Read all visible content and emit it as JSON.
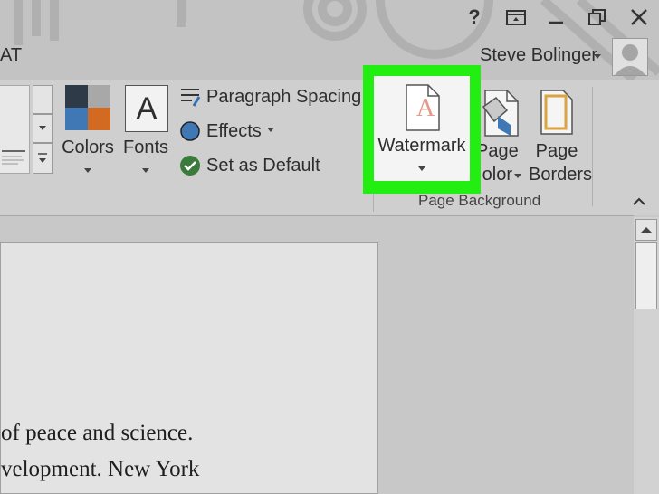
{
  "window": {
    "tab_fragment": "AT",
    "user_name": "Steve Bolinger",
    "help_icon": "help-icon",
    "restore_ribbon_icon": "ribbon-display-icon",
    "minimize_icon": "minimize-icon",
    "maximize_icon": "restore-icon",
    "close_icon": "close-icon"
  },
  "ribbon": {
    "colors_label": "Colors",
    "fonts_label": "Fonts",
    "fonts_glyph": "A",
    "paragraph_spacing_label": "Paragraph Spacing",
    "effects_label": "Effects",
    "set_default_label": "Set as Default",
    "watermark_label": "Watermark",
    "watermark_glyph": "A",
    "page_color_label_1": "Page",
    "page_color_label_2": "olor",
    "page_borders_label_1": "Page",
    "page_borders_label_2": "Borders",
    "group_label": "Page Background",
    "highlight_color": "#22ee11"
  },
  "document": {
    "line1": "of peace and science.",
    "line2": "velopment. New York"
  }
}
